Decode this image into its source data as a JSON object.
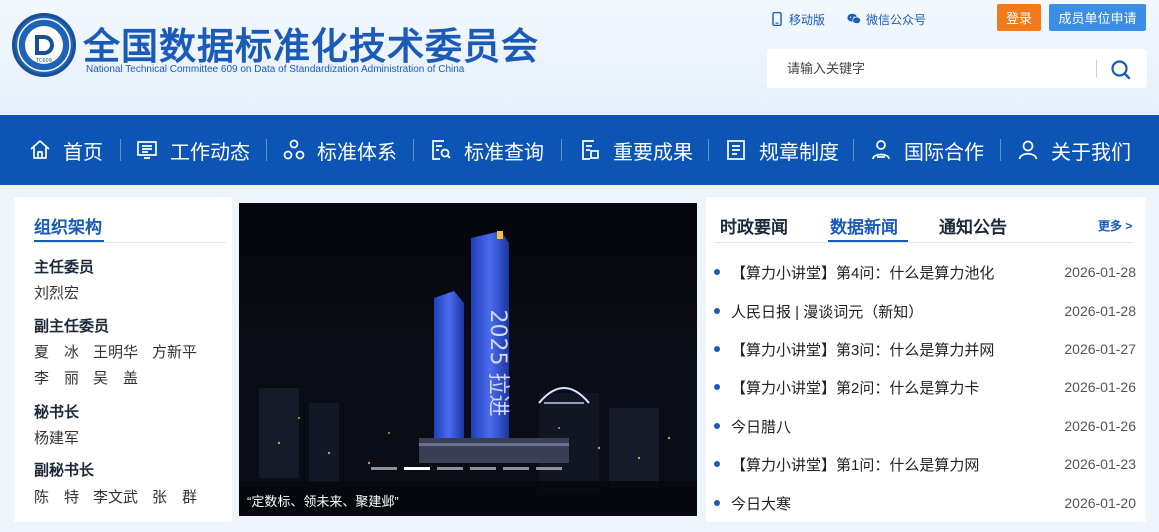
{
  "header": {
    "logo_text": "TC609",
    "title": "全国数据标准化技术委员会",
    "subtitle": "National Technical Committee 609 on Data of Standardization Administration of China",
    "links": [
      {
        "label": "移动版",
        "icon": "mobile-icon"
      },
      {
        "label": "微信公众号",
        "icon": "wechat-icon"
      }
    ],
    "login_label": "登录",
    "apply_label": "成员单位申请",
    "search_placeholder": "请输入关键字"
  },
  "nav": {
    "items": [
      {
        "label": "首页",
        "icon": "home-icon"
      },
      {
        "label": "工作动态",
        "icon": "news-screen-icon"
      },
      {
        "label": "标准体系",
        "icon": "system-icon"
      },
      {
        "label": "标准查询",
        "icon": "doc-search-icon"
      },
      {
        "label": "重要成果",
        "icon": "achievement-doc-icon"
      },
      {
        "label": "规章制度",
        "icon": "rules-doc-icon"
      },
      {
        "label": "国际合作",
        "icon": "cooperation-icon"
      },
      {
        "label": "关于我们",
        "icon": "user-icon"
      }
    ]
  },
  "organization": {
    "title": "组织架构",
    "roles": [
      {
        "title": "主任委员",
        "names": [
          "刘烈宏"
        ]
      },
      {
        "title": "副主任委员",
        "names": [
          "夏　冰",
          "王明华",
          "方新平",
          "李　丽",
          "吴　盖"
        ]
      },
      {
        "title": "秘书长",
        "names": [
          "杨建军"
        ]
      },
      {
        "title": "副秘书长",
        "names": [
          "陈　特",
          "李文武",
          "张　群"
        ]
      }
    ]
  },
  "banner": {
    "caption": "“定数标、领未来、聚建邺”",
    "tower_text": "2025 拉进",
    "slide_count": 6,
    "active_slide": 2
  },
  "news": {
    "tabs": [
      "时政要闻",
      "数据新闻",
      "通知公告"
    ],
    "active_tab": 1,
    "more_label": "更多 >",
    "items": [
      {
        "title": "【算力小讲堂】第4问：什么是算力池化",
        "date": "2026-01-28"
      },
      {
        "title": "人民日报 | 漫谈词元（新知）",
        "date": "2026-01-28"
      },
      {
        "title": "【算力小讲堂】第3问：什么是算力并网",
        "date": "2026-01-27"
      },
      {
        "title": "【算力小讲堂】第2问：什么是算力卡",
        "date": "2026-01-26"
      },
      {
        "title": "今日腊八",
        "date": "2026-01-26"
      },
      {
        "title": "【算力小讲堂】第1问：什么是算力网",
        "date": "2026-01-23"
      },
      {
        "title": "今日大寒",
        "date": "2026-01-20"
      }
    ]
  },
  "colors": {
    "brand_blue": "#1a5bb8",
    "nav_blue": "#0c55b4",
    "login_orange": "#f07a1c",
    "apply_blue": "#3a8ee6"
  }
}
